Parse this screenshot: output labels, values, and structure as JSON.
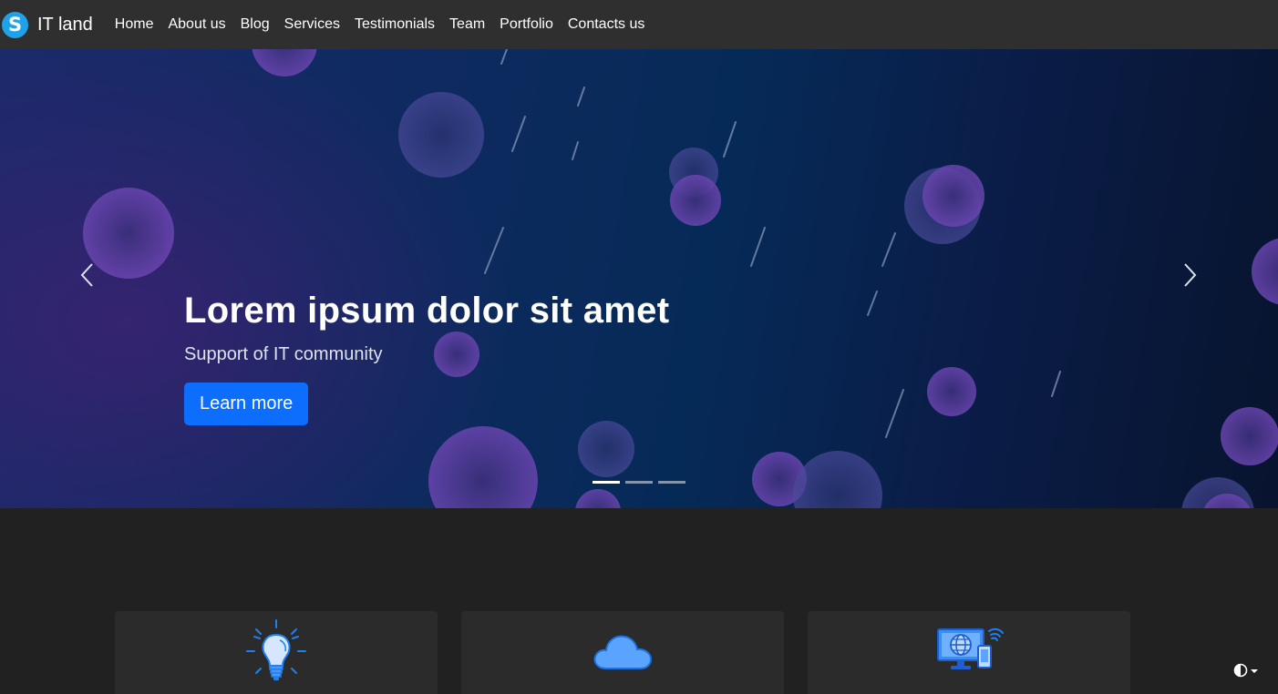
{
  "brand": {
    "logo_letter": "S",
    "name": "IT land",
    "logo_color": "#1fa3e8"
  },
  "nav": {
    "items": [
      {
        "label": "Home"
      },
      {
        "label": "About us"
      },
      {
        "label": "Blog"
      },
      {
        "label": "Services"
      },
      {
        "label": "Testimonials"
      },
      {
        "label": "Team"
      },
      {
        "label": "Portfolio"
      },
      {
        "label": "Contacts us"
      }
    ]
  },
  "hero": {
    "title": "Lorem ipsum dolor sit amet",
    "subtitle": "Support of IT community",
    "button_label": "Learn more",
    "prev_icon": "chevron-left-icon",
    "next_icon": "chevron-right-icon",
    "slide_count": 3,
    "active_slide": 1
  },
  "features": {
    "cards": [
      {
        "icon": "lightbulb-icon"
      },
      {
        "icon": "cloud-icon"
      },
      {
        "icon": "computer-network-icon"
      }
    ]
  },
  "theme_toggle": {
    "icon": "contrast-icon"
  },
  "colors": {
    "accent": "#0d6efd",
    "navbar_bg": "#2f2f2f",
    "page_bg": "#212121",
    "card_bg": "#2b2b2b",
    "bubble": "#7a4bbd"
  }
}
